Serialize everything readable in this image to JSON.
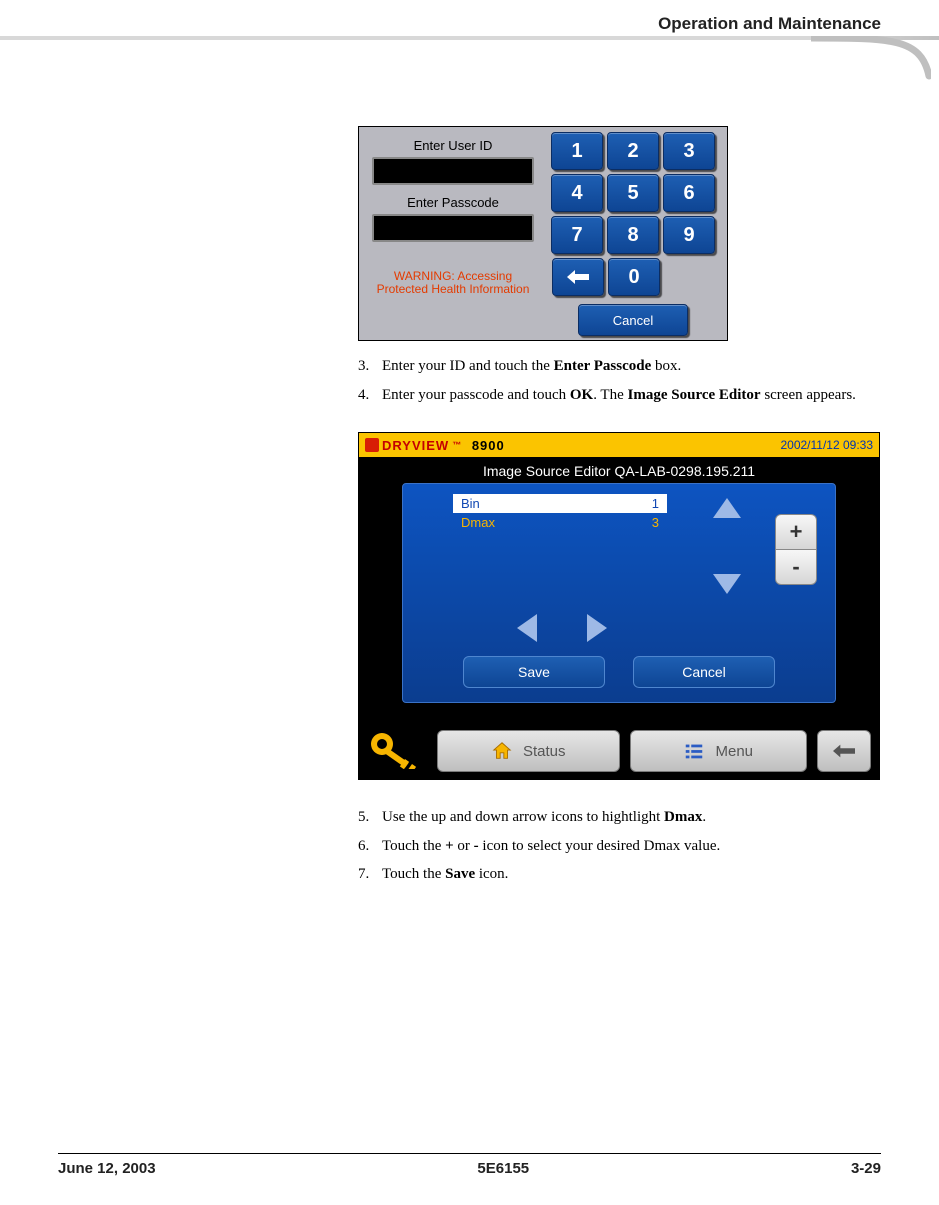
{
  "header": {
    "section_title": "Operation and Maintenance"
  },
  "screenshot1": {
    "label_user_id": "Enter User ID",
    "label_passcode": "Enter Passcode",
    "warning_line1": "WARNING: Accessing",
    "warning_line2": "Protected Health Information",
    "keys": {
      "k1": "1",
      "k2": "2",
      "k3": "3",
      "k4": "4",
      "k5": "5",
      "k6": "6",
      "k7": "7",
      "k8": "8",
      "k9": "9",
      "k0": "0"
    },
    "cancel": "Cancel"
  },
  "steps_a": [
    {
      "num": "3.",
      "pre": "Enter your ID and touch the ",
      "bold": "Enter Passcode",
      "post": " box."
    },
    {
      "num": "4.",
      "pre": "Enter your passcode and touch ",
      "bold": "OK",
      "post": ". The ",
      "bold2": "Image Source Editor",
      "post2": " screen appears."
    }
  ],
  "screenshot2": {
    "brand_dry": "DRYVIEW",
    "brand_tm": "™",
    "brand_num": "8900",
    "timestamp": "2002/11/12 09:33",
    "screen_title": "Image Source Editor QA-LAB-0298.195.211",
    "rows": [
      {
        "label": "Bin",
        "value": "1",
        "selected": true
      },
      {
        "label": "Dmax",
        "value": "3",
        "selected": false
      }
    ],
    "plus": "+",
    "minus": "-",
    "save": "Save",
    "cancel": "Cancel",
    "nav_status": "Status",
    "nav_menu": "Menu"
  },
  "steps_b": [
    {
      "num": "5.",
      "pre": "Use the up and down arrow icons to hightlight ",
      "bold": "Dmax",
      "post": "."
    },
    {
      "num": "6.",
      "pre": "Touch the ",
      "bold": "+",
      "post": " or ",
      "bold2": "-",
      "post2": " icon to select your desired Dmax value."
    },
    {
      "num": "7.",
      "pre": "Touch the ",
      "bold": "Save",
      "post": " icon."
    }
  ],
  "footer": {
    "date": "June 12, 2003",
    "doc": "5E6155",
    "page": "3-29"
  }
}
